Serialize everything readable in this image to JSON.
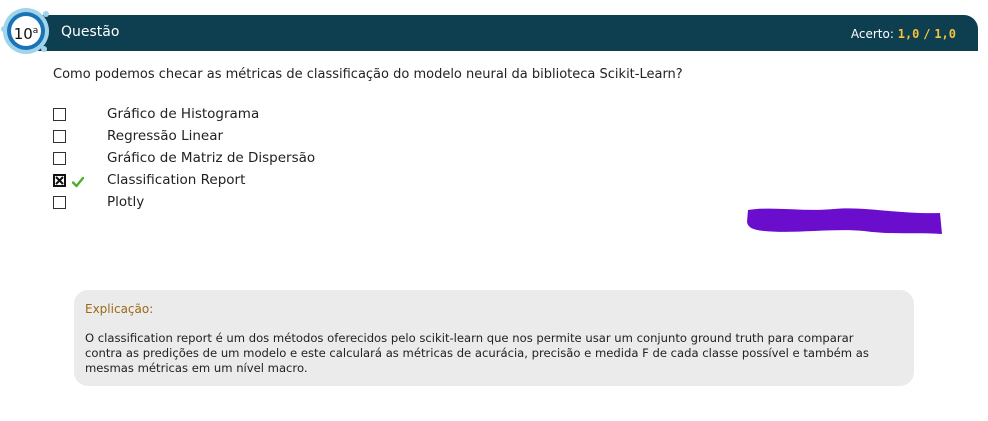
{
  "question_header": {
    "number": "10",
    "ordinal_suffix": "a",
    "title": "Questão",
    "score_label": "Acerto:",
    "score_value": "1,0",
    "score_separator": "/",
    "score_total": "1,0"
  },
  "question": {
    "text": "Como podemos checar as métricas de classificação do modelo neural da biblioteca Scikit-Learn?"
  },
  "options": [
    {
      "label": "Gráfico de Histograma",
      "checked": false,
      "correct_mark": false
    },
    {
      "label": "Regressão Linear",
      "checked": false,
      "correct_mark": false
    },
    {
      "label": "Gráfico de Matriz de Dispersão",
      "checked": false,
      "correct_mark": false
    },
    {
      "label": "Classification Report",
      "checked": true,
      "correct_mark": true
    },
    {
      "label": "Plotly",
      "checked": false,
      "correct_mark": false
    }
  ],
  "icons": {
    "correct": "check-mark-icon",
    "checked_box": "checked-checkbox-icon"
  },
  "explanation": {
    "title": "Explicação:",
    "text": "O classification report é um dos métodos oferecidos pelo scikit-learn que nos permite usar um conjunto ground truth para comparar contra as predições de um modelo e este calculará as métricas de acurácia, precisão e medida F de cada classe possível e também as mesmas métricas em um nível macro."
  },
  "colors": {
    "header_bg": "#0d3f51",
    "score_accent": "#f6c23a",
    "explanation_title": "#9b6a16",
    "explanation_bg": "#ebebeb",
    "check_green": "#4caf2a",
    "redaction": "#6a0dcc"
  }
}
